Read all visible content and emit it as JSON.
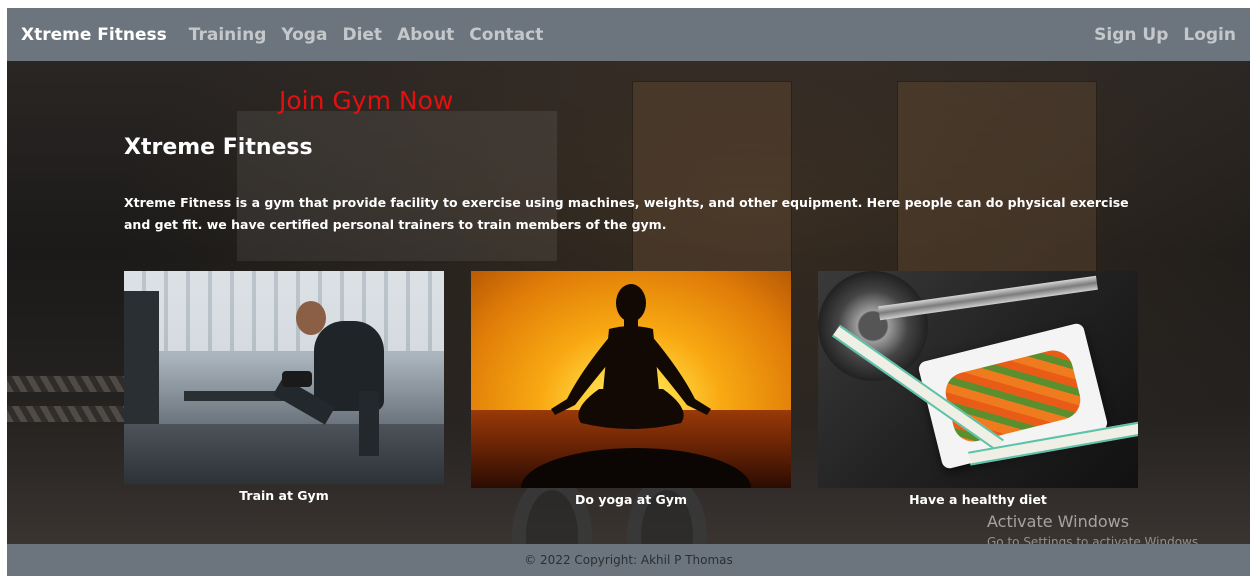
{
  "navbar": {
    "brand": "Xtreme Fitness",
    "links": [
      "Training",
      "Yoga",
      "Diet",
      "About",
      "Contact"
    ],
    "right_links": [
      "Sign Up",
      "Login"
    ]
  },
  "hero": {
    "join": "Join Gym Now",
    "title": "Xtreme Fitness",
    "description": "Xtreme Fitness is a gym that provide facility to exercise using machines, weights, and other equipment. Here people can do physical exercise and get fit. we have certified personal trainers to train members of the gym."
  },
  "cards": [
    {
      "caption": "Train at Gym"
    },
    {
      "caption": "Do yoga at Gym"
    },
    {
      "caption": "Have a healthy diet"
    }
  ],
  "watermark": {
    "title": "Activate Windows",
    "subtitle": "Go to Settings to activate Windows."
  },
  "footer": {
    "text": "© 2022 Copyright: Akhil P Thomas"
  },
  "colors": {
    "navbar_bg": "#6c757d",
    "join_text": "#e3100f"
  }
}
